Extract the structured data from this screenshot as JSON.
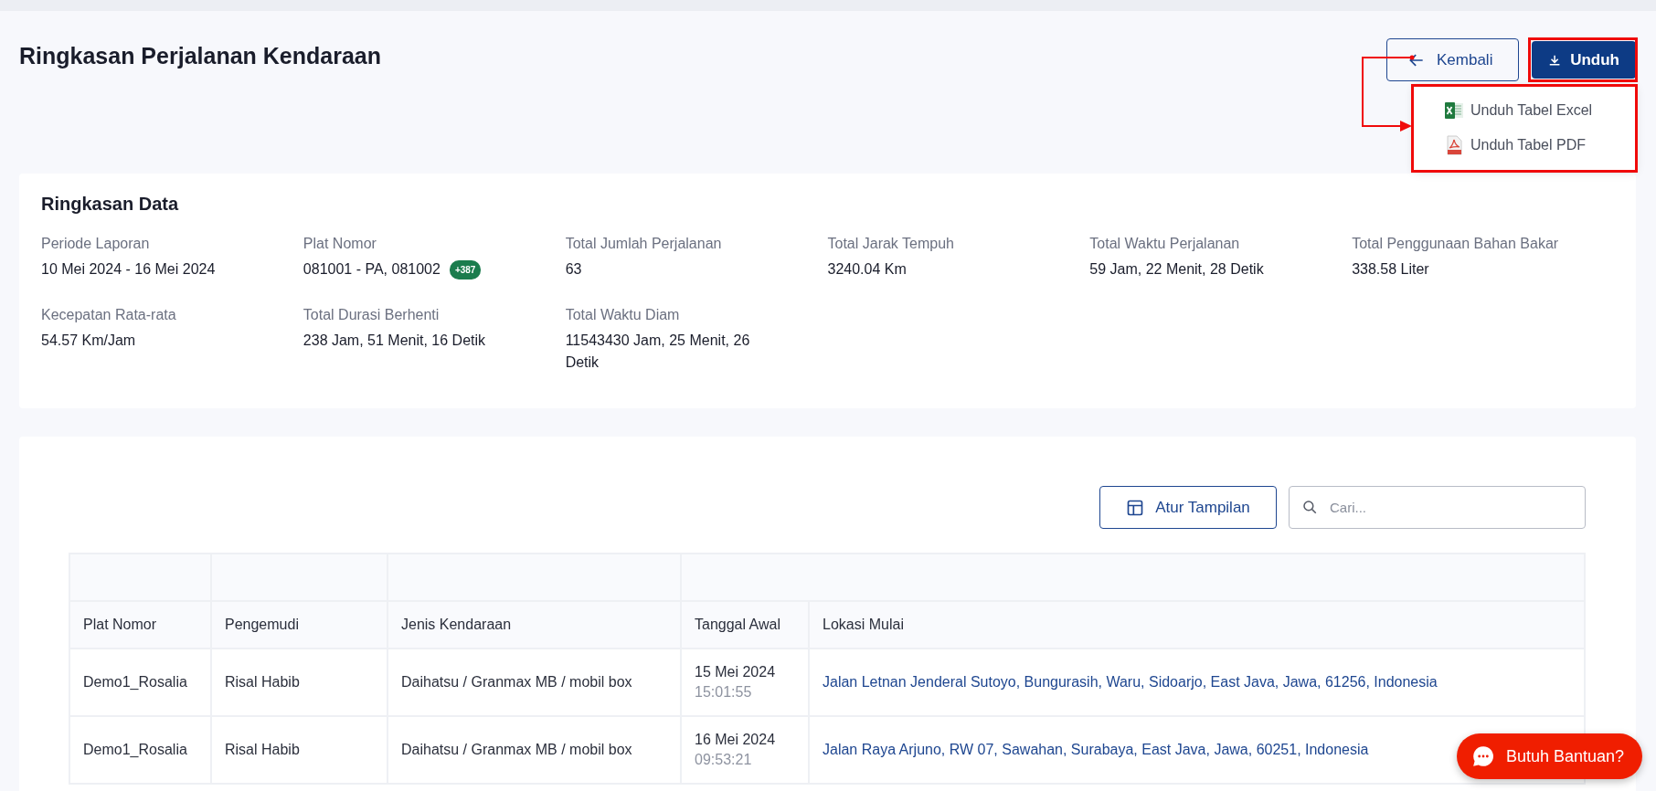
{
  "page": {
    "title": "Ringkasan Perjalanan Kendaraan"
  },
  "header_buttons": [
    {
      "label": "Kembali",
      "kind": "back"
    },
    {
      "label": "Unduh",
      "kind": "download"
    }
  ],
  "download_menu": {
    "items": [
      {
        "label": "Unduh Tabel Excel",
        "kind": "excel"
      },
      {
        "label": "Unduh Tabel PDF",
        "kind": "pdf"
      }
    ]
  },
  "annotations": [
    {
      "kind": "frame-button"
    },
    {
      "kind": "frame-menu"
    },
    {
      "kind": "arrow"
    }
  ],
  "summary": {
    "title": "Ringkasan Data",
    "fields": [
      {
        "label": "Periode Laporan",
        "value": "10 Mei 2024 - 16 Mei 2024"
      },
      {
        "label": "Plat Nomor",
        "value": "081001 - PA, 081002",
        "badge": "+387"
      },
      {
        "label": "Total Jumlah Perjalanan",
        "value": "63"
      },
      {
        "label": "Total Jarak Tempuh",
        "value": "3240.04 Km"
      },
      {
        "label": "Total Waktu Perjalanan",
        "value": "59 Jam, 22 Menit, 28 Detik"
      },
      {
        "label": "Total Penggunaan Bahan Bakar",
        "value": "338.58 Liter"
      },
      {
        "label": "Kecepatan Rata-rata",
        "value": "54.57 Km/Jam"
      },
      {
        "label": "Total Durasi Berhenti",
        "value": "238 Jam, 51 Menit, 16 Detik"
      },
      {
        "label": "Total Waktu Diam",
        "value": "11543430 Jam, 25 Menit, 26 Detik"
      }
    ]
  },
  "table_toolbar": {
    "columns_button": "Atur Tampilan",
    "search": {
      "placeholder": "Cari..."
    }
  },
  "table": {
    "columns": [
      "Plat Nomor",
      "Pengemudi",
      "Jenis Kendaraan",
      "Tanggal Awal",
      "Lokasi Mulai"
    ],
    "rows": [
      {
        "plat_nomor": "Demo1_Rosalia",
        "pengemudi": "Risal Habib",
        "jenis_kendaraan": "Daihatsu / Granmax MB / mobil box",
        "tanggal": "15 Mei 2024",
        "jam": "15:01:55",
        "lokasi_mulai": "Jalan Letnan Jenderal Sutoyo, Bungurasih, Waru, Sidoarjo, East Java, Jawa, 61256, Indonesia"
      },
      {
        "plat_nomor": "Demo1_Rosalia",
        "pengemudi": "Risal Habib",
        "jenis_kendaraan": "Daihatsu / Granmax MB / mobil box",
        "tanggal": "16 Mei 2024",
        "jam": "09:53:21",
        "lokasi_mulai": "Jalan Raya Arjuno, RW 07, Sawahan, Surabaya, East Java, Jawa, 60251, Indonesia"
      }
    ]
  },
  "help_button": {
    "label": "Butuh Bantuan?"
  }
}
